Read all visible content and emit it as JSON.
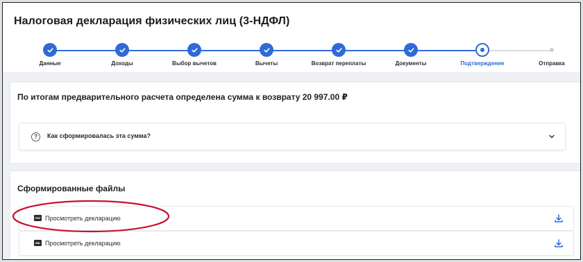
{
  "page": {
    "title": "Налоговая декларация физических лиц (3-НДФЛ)"
  },
  "stepper": {
    "steps": [
      {
        "label": "Данные",
        "state": "done"
      },
      {
        "label": "Доходы",
        "state": "done"
      },
      {
        "label": "Выбор вычетов",
        "state": "done"
      },
      {
        "label": "Вычеты",
        "state": "done"
      },
      {
        "label": "Возврат переплаты",
        "state": "done"
      },
      {
        "label": "Документы",
        "state": "done"
      },
      {
        "label": "Подтверждение",
        "state": "current"
      },
      {
        "label": "Отправка",
        "state": "pending"
      }
    ]
  },
  "result": {
    "text": "По итогам предварительного расчета определена сумма к возврату 20 997.00 ₽",
    "accordion": {
      "icon": "question-circle-icon",
      "label": "Как сформировалась эта сумма?",
      "chevron": "chevron-down-icon"
    }
  },
  "files": {
    "title": "Сформированные файлы",
    "items": [
      {
        "badge": "PDF",
        "label": "Просмотреть декларацию",
        "icon": "download-icon"
      },
      {
        "badge": "XML",
        "label": "Просмотреть декларацию",
        "icon": "download-icon"
      }
    ]
  },
  "colors": {
    "accent": "#2f6ad8",
    "annotation": "#c8102e"
  }
}
